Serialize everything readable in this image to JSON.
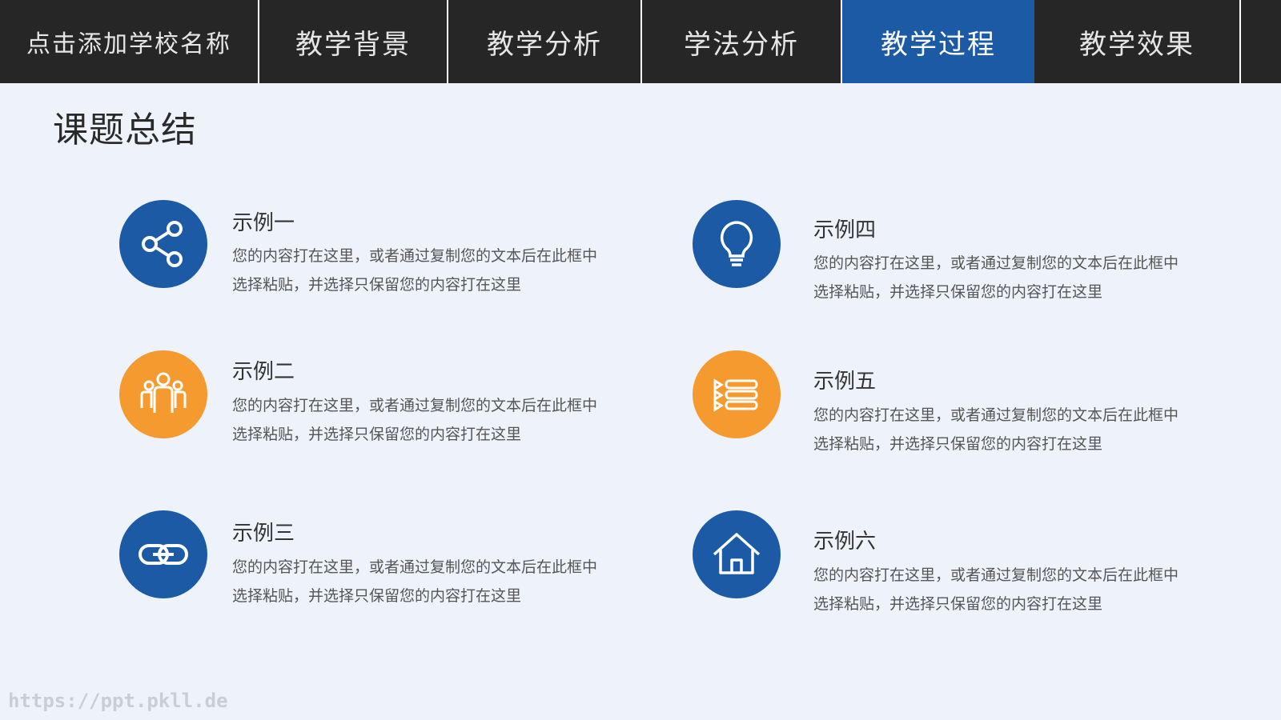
{
  "nav": {
    "school": "点击添加学校名称",
    "tabs": [
      "教学背景",
      "教学分析",
      "学法分析",
      "教学过程",
      "教学效果"
    ],
    "active_tab": "教学过程"
  },
  "page_title": "课题总结",
  "desc_text": "您的内容打在这里，或者通过复制您的文本后在此框中选择粘贴，并选择只保留您的内容打在这里",
  "items": [
    {
      "title": "示例一",
      "desc": "您的内容打在这里，或者通过复制您的文本后在此框中选择粘贴，并选择只保留您的内容打在这里",
      "icon": "share-icon",
      "color": "#1c5aa6"
    },
    {
      "title": "示例二",
      "desc": "您的内容打在这里，或者通过复制您的文本后在此框中选择粘贴，并选择只保留您的内容打在这里",
      "icon": "team-icon",
      "color": "#f59a2e"
    },
    {
      "title": "示例三",
      "desc": "您的内容打在这里，或者通过复制您的文本后在此框中选择粘贴，并选择只保留您的内容打在这里",
      "icon": "link-icon",
      "color": "#1c5aa6"
    },
    {
      "title": "示例四",
      "desc": "您的内容打在这里，或者通过复制您的文本后在此框中选择粘贴，并选择只保留您的内容打在这里",
      "icon": "lightbulb-icon",
      "color": "#1c5aa6"
    },
    {
      "title": "示例五",
      "desc": "您的内容打在这里，或者通过复制您的文本后在此框中选择粘贴，并选择只保留您的内容打在这里",
      "icon": "list-icon",
      "color": "#f59a2e"
    },
    {
      "title": "示例六",
      "desc": "您的内容打在这里，或者通过复制您的文本后在此框中选择粘贴，并选择只保留您的内容打在这里",
      "icon": "home-icon",
      "color": "#1c5aa6"
    }
  ],
  "watermark": "https://ppt.pkll.de"
}
